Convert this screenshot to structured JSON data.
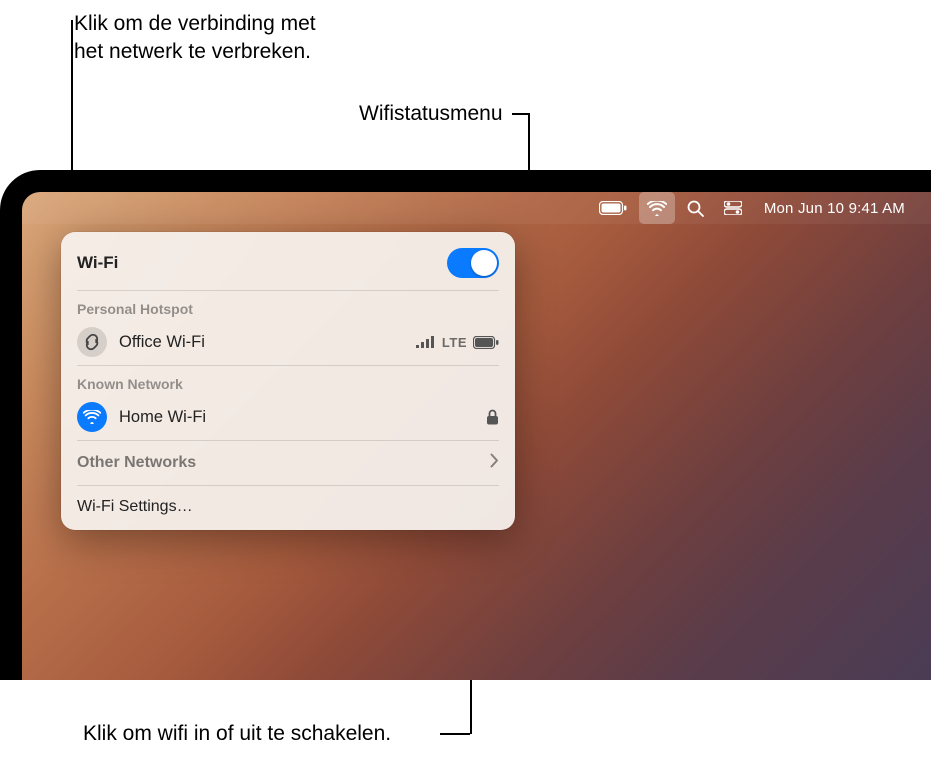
{
  "callouts": {
    "disconnect": "Klik om de verbinding met\nhet netwerk te verbreken.",
    "statusmenu": "Wifistatusmenu",
    "toggle": "Klik om wifi in of uit te schakelen."
  },
  "menubar": {
    "clock": "Mon Jun 10  9:41 AM"
  },
  "wifi": {
    "title": "Wi-Fi",
    "toggle_on": true,
    "sections": {
      "hotspot_label": "Personal Hotspot",
      "known_label": "Known Network"
    },
    "hotspot": {
      "name": "Office Wi-Fi",
      "signal_label": "LTE"
    },
    "known": {
      "name": "Home Wi-Fi"
    },
    "other_networks": "Other Networks",
    "settings": "Wi-Fi Settings…"
  }
}
